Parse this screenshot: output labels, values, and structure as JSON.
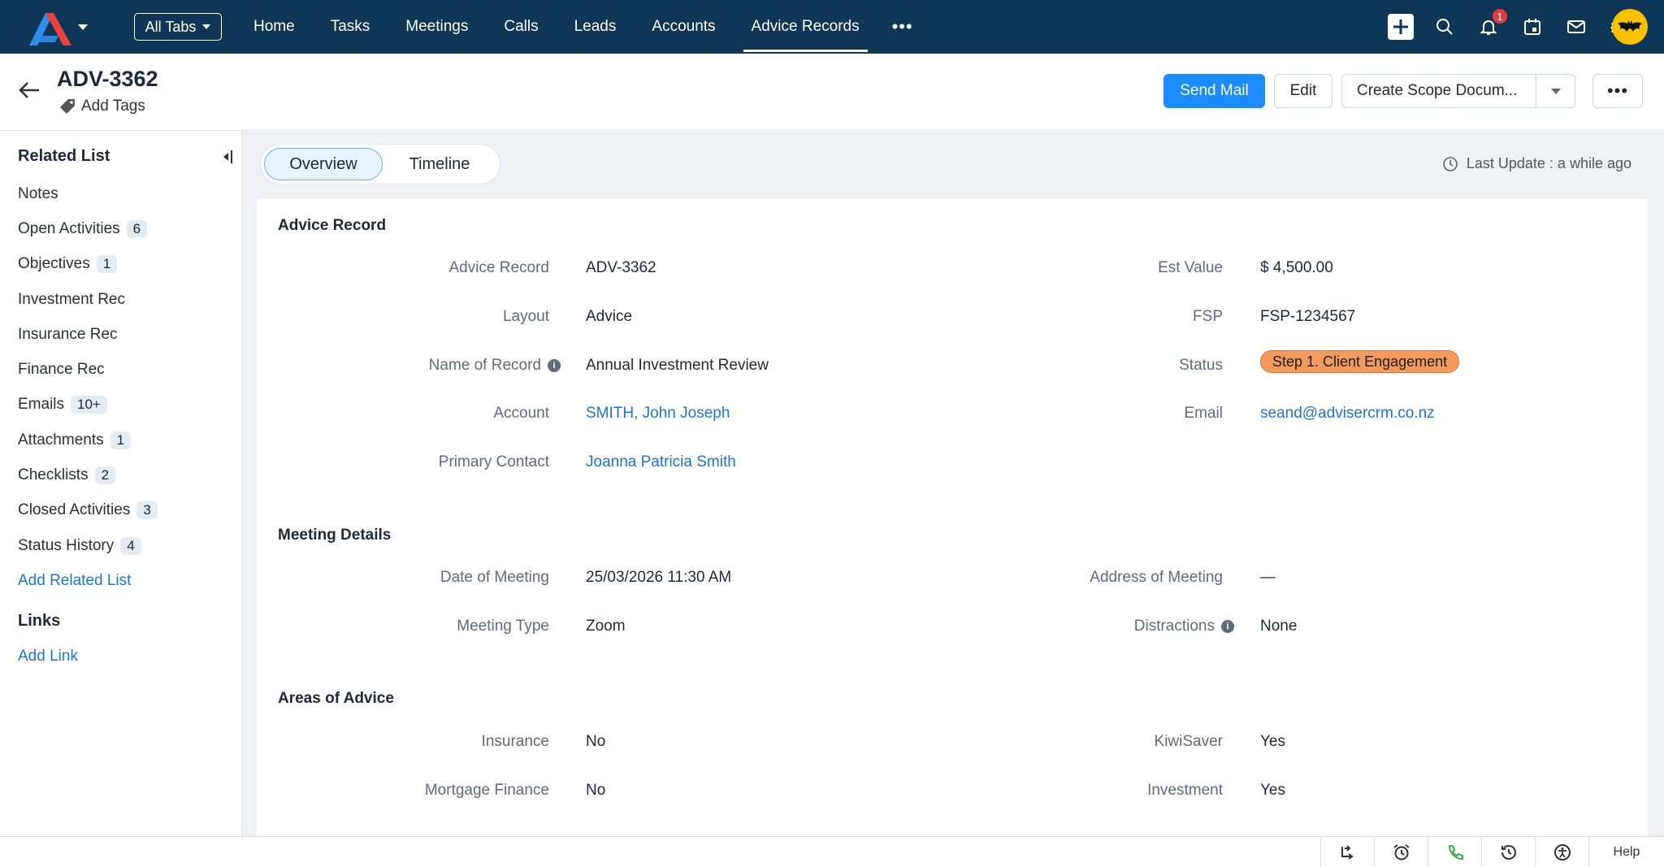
{
  "nav": {
    "all_tabs": "All Tabs",
    "tabs": [
      "Home",
      "Tasks",
      "Meetings",
      "Calls",
      "Leads",
      "Accounts",
      "Advice Records"
    ],
    "active_tab": "Advice Records",
    "more": "•••",
    "notification_count": "1",
    "brand_color": "#0d3657"
  },
  "header": {
    "title": "ADV-3362",
    "add_tags": "Add Tags",
    "send_mail": "Send Mail",
    "edit": "Edit",
    "create_scope": "Create Scope Docum...",
    "more": "•••"
  },
  "sidebar": {
    "heading": "Related List",
    "items": [
      {
        "label": "Notes",
        "count": ""
      },
      {
        "label": "Open Activities",
        "count": "6"
      },
      {
        "label": "Objectives",
        "count": "1"
      },
      {
        "label": "Investment Rec",
        "count": ""
      },
      {
        "label": "Insurance Rec",
        "count": ""
      },
      {
        "label": "Finance Rec",
        "count": ""
      },
      {
        "label": "Emails",
        "count": "10+"
      },
      {
        "label": "Attachments",
        "count": "1"
      },
      {
        "label": "Checklists",
        "count": "2"
      },
      {
        "label": "Closed Activities",
        "count": "3"
      },
      {
        "label": "Status History",
        "count": "4"
      }
    ],
    "add_related": "Add Related List",
    "links_heading": "Links",
    "add_link": "Add Link"
  },
  "main": {
    "tabs": [
      "Overview",
      "Timeline"
    ],
    "last_update": "Last Update : a while ago",
    "sections": {
      "advice_record": {
        "title": "Advice Record",
        "advice_record_label": "Advice Record",
        "advice_record_value": "ADV-3362",
        "layout_label": "Layout",
        "layout_value": "Advice",
        "name_label": "Name of Record",
        "name_value": "Annual Investment Review",
        "account_label": "Account",
        "account_value": "SMITH, John Joseph",
        "primary_contact_label": "Primary Contact",
        "primary_contact_value": "Joanna Patricia Smith",
        "est_value_label": "Est Value",
        "est_value_value": "$ 4,500.00",
        "fsp_label": "FSP",
        "fsp_value": "FSP-1234567",
        "status_label": "Status",
        "status_value": "Step 1. Client Engagement",
        "email_label": "Email",
        "email_value": "seand@advisercrm.co.nz"
      },
      "meeting": {
        "title": "Meeting Details",
        "date_label": "Date of Meeting",
        "date_value": "25/03/2026 11:30 AM",
        "type_label": "Meeting Type",
        "type_value": "Zoom",
        "address_label": "Address of Meeting",
        "address_value": "—",
        "distractions_label": "Distractions",
        "distractions_value": "None"
      },
      "areas": {
        "title": "Areas of Advice",
        "insurance_label": "Insurance",
        "insurance_value": "No",
        "mortgage_label": "Mortgage Finance",
        "mortgage_value": "No",
        "kiwisaver_label": "KiwiSaver",
        "kiwisaver_value": "Yes",
        "investment_label": "Investment",
        "investment_value": "Yes"
      }
    }
  },
  "bottom": {
    "help": "Help"
  }
}
